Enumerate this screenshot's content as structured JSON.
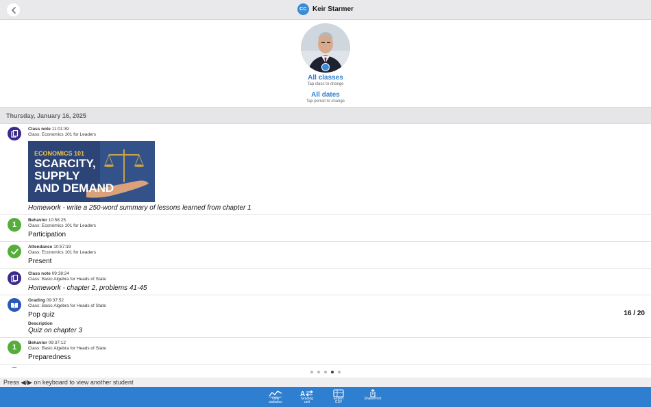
{
  "header": {
    "avatar_initials": "CC",
    "title": "Keir Starmer"
  },
  "profile": {
    "class_filter": "All classes",
    "class_hint": "Tap class to change",
    "date_filter": "All dates",
    "date_hint": "Tap period to change"
  },
  "date_section": "Thursday, January 16, 2025",
  "entries": [
    {
      "type": "Class note",
      "time": "11:01:39",
      "class": "Class: Economics 101 for Leaders",
      "icon": "notes-icon",
      "image": {
        "line1": "ECONOMICS 101",
        "line2": "SCARCITY,",
        "line3": "SUPPLY",
        "line4": "AND DEMAND"
      },
      "text": "Homework - write a 250-word summary of lessons learned from chapter 1"
    },
    {
      "type": "Behavior",
      "time": "10:58:25",
      "class": "Class: Economics 101 for Leaders",
      "icon_text": "1",
      "text": "Participation"
    },
    {
      "type": "Attendance",
      "time": "10:57:19",
      "class": "Class: Economics 101 for Leaders",
      "icon": "checkmark-icon",
      "text": "Present"
    },
    {
      "type": "Class note",
      "time": "09:38:24",
      "class": "Class: Basic Algebra for Heads of State",
      "icon": "notes-icon",
      "text": "Homework - chapter 2, problems 41-45"
    },
    {
      "type": "Grading",
      "time": "09:37:52",
      "class": "Class: Basic Algebra for Heads of State",
      "icon": "book-icon",
      "text": "Pop quiz",
      "score": "16 / 20",
      "desc_label": "Description",
      "desc": "Quiz on chapter 3"
    },
    {
      "type": "Behavior",
      "time": "09:37:12",
      "class": "Class: Basic Algebra for Heads of State",
      "icon_text": "1",
      "text": "Preparedness"
    }
  ],
  "pager": {
    "count": 5,
    "active": 4
  },
  "hint": "Press ◀/▶ on keyboard to view another student",
  "toolbar": {
    "view_stats": "View\nstatistics",
    "grading_unit": "Grading\nunit",
    "export_csv": "Export\nCSV",
    "share_print": "Share/Print"
  },
  "colors": {
    "accent": "#2f7fd1",
    "note": "#3b2a8c",
    "green": "#55ad3a",
    "grading": "#2a59b8"
  }
}
